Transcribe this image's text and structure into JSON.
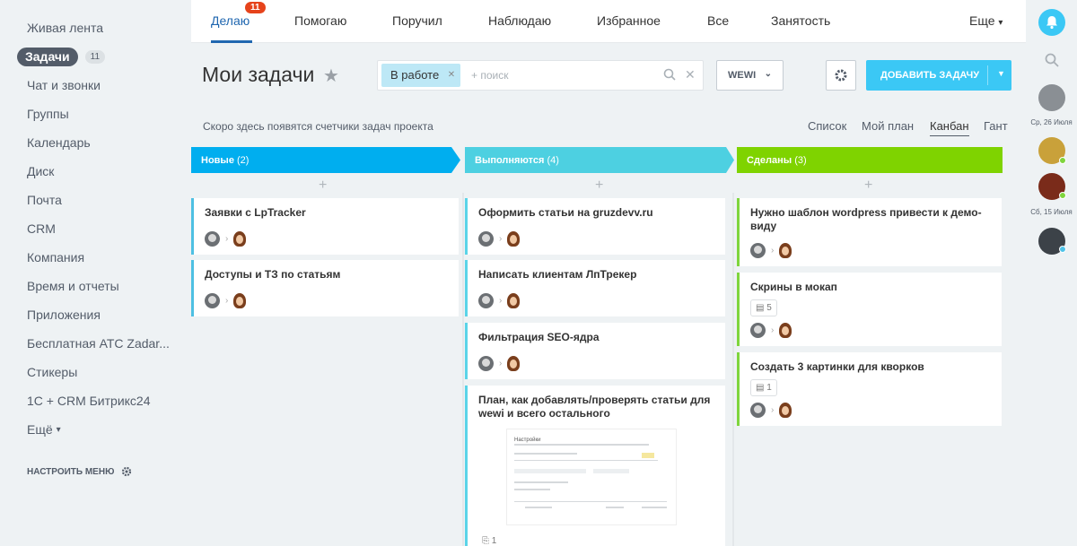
{
  "sidebar": {
    "items": [
      {
        "label": "Живая лента"
      },
      {
        "label": "Задачи",
        "count": "11"
      },
      {
        "label": "Чат и звонки"
      },
      {
        "label": "Группы"
      },
      {
        "label": "Календарь"
      },
      {
        "label": "Диск"
      },
      {
        "label": "Почта"
      },
      {
        "label": "CRM"
      },
      {
        "label": "Компания"
      },
      {
        "label": "Время и отчеты"
      },
      {
        "label": "Приложения"
      },
      {
        "label": "Бесплатная АТС Zadar..."
      },
      {
        "label": "Стикеры"
      },
      {
        "label": "1С + CRM Битрикс24"
      },
      {
        "label": "Ещё"
      }
    ],
    "configure_label": "НАСТРОИТЬ МЕНЮ"
  },
  "tabs": {
    "items": [
      "Делаю",
      "Помогаю",
      "Поручил",
      "Наблюдаю",
      "Избранное",
      "Все",
      "Занятость"
    ],
    "badge": "11",
    "more": "Еще"
  },
  "header": {
    "title": "Мои задачи",
    "filter_chip": "В работе",
    "search_placeholder": "+ поиск",
    "project_select": "WEWI",
    "add_button": "ДОБАВИТЬ ЗАДАЧУ",
    "counters_text": "Скоро здесь появятся счетчики задач проекта",
    "views": [
      "Список",
      "Мой план",
      "Канбан",
      "Гант"
    ],
    "active_view": "Канбан"
  },
  "board": {
    "stages": [
      {
        "name": "Новые",
        "count": "(2)",
        "color": "#00aeef"
      },
      {
        "name": "Выполняются",
        "count": "(4)",
        "color": "#4dd0e1"
      },
      {
        "name": "Сделаны",
        "count": "(3)",
        "color": "#7fd300"
      }
    ],
    "new": [
      {
        "title": "Заявки с LpTracker"
      },
      {
        "title": "Доступы и ТЗ по статьям"
      }
    ],
    "progress": [
      {
        "title": "Оформить статьи на gruzdevv.ru"
      },
      {
        "title": "Написать клиентам ЛпТрекер"
      },
      {
        "title": "Фильтрация SEO-ядра"
      },
      {
        "title": "План, как добавлять/проверять статьи для wewi и всего остального",
        "files": "1",
        "thumb_title": "Настройки"
      }
    ],
    "done": [
      {
        "title": "Нужно шаблон wordpress привести к демо-виду"
      },
      {
        "title": "Скрины в мокап",
        "comments": "5"
      },
      {
        "title": "Создать 3 картинки для кворков",
        "comments": "1"
      }
    ]
  },
  "right_bar": {
    "dates": [
      "Ср, 26 Июля",
      "Сб, 15 Июля"
    ]
  }
}
